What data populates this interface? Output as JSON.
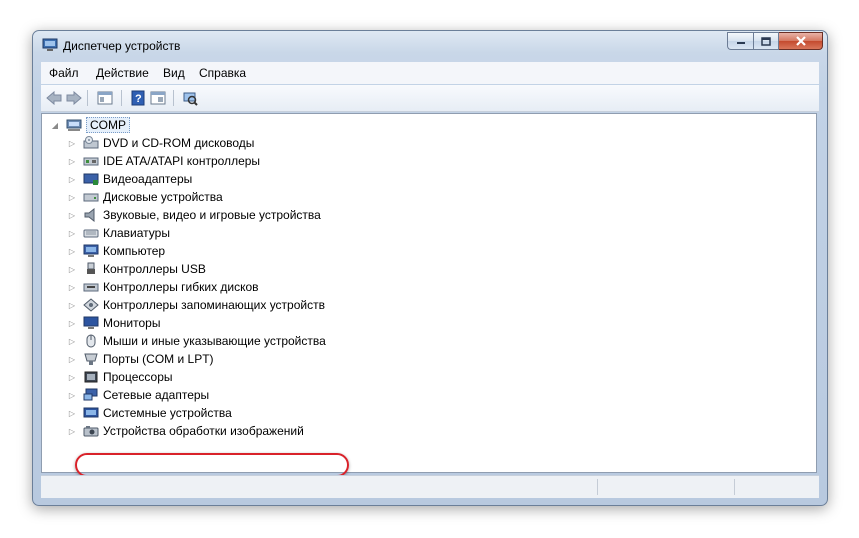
{
  "window": {
    "title": "Диспетчер устройств"
  },
  "menu": [
    {
      "label": "Файл"
    },
    {
      "label": "Действие"
    },
    {
      "label": "Вид"
    },
    {
      "label": "Справка"
    }
  ],
  "toolbar": {
    "buttons": [
      "back-arrow-icon",
      "forward-arrow-icon",
      "properties-icon",
      "help-icon",
      "view-icon",
      "scan-hardware-icon"
    ]
  },
  "tree": {
    "root": "COMP",
    "items": [
      {
        "label": "DVD и CD-ROM дисководы",
        "icon": "dvd-drive-icon"
      },
      {
        "label": "IDE ATA/ATAPI контроллеры",
        "icon": "ide-controller-icon"
      },
      {
        "label": "Видеоадаптеры",
        "icon": "display-adapter-icon"
      },
      {
        "label": "Дисковые устройства",
        "icon": "disk-drive-icon"
      },
      {
        "label": "Звуковые, видео и игровые устройства",
        "icon": "speaker-icon"
      },
      {
        "label": "Клавиатуры",
        "icon": "keyboard-icon"
      },
      {
        "label": "Компьютер",
        "icon": "computer-icon"
      },
      {
        "label": "Контроллеры USB",
        "icon": "usb-icon"
      },
      {
        "label": "Контроллеры гибких дисков",
        "icon": "floppy-controller-icon"
      },
      {
        "label": "Контроллеры запоминающих устройств",
        "icon": "storage-controller-icon"
      },
      {
        "label": "Мониторы",
        "icon": "monitor-icon"
      },
      {
        "label": "Мыши и иные указывающие устройства",
        "icon": "mouse-icon"
      },
      {
        "label": "Порты (COM и LPT)",
        "icon": "port-icon"
      },
      {
        "label": "Процессоры",
        "icon": "processor-icon"
      },
      {
        "label": "Сетевые адаптеры",
        "icon": "network-adapter-icon"
      },
      {
        "label": "Системные устройства",
        "icon": "system-devices-icon"
      },
      {
        "label": "Устройства обработки изображений",
        "icon": "camera-icon"
      }
    ]
  },
  "colors": {
    "highlight": "#d9222a",
    "selection_bg": "#e6f0fb"
  }
}
